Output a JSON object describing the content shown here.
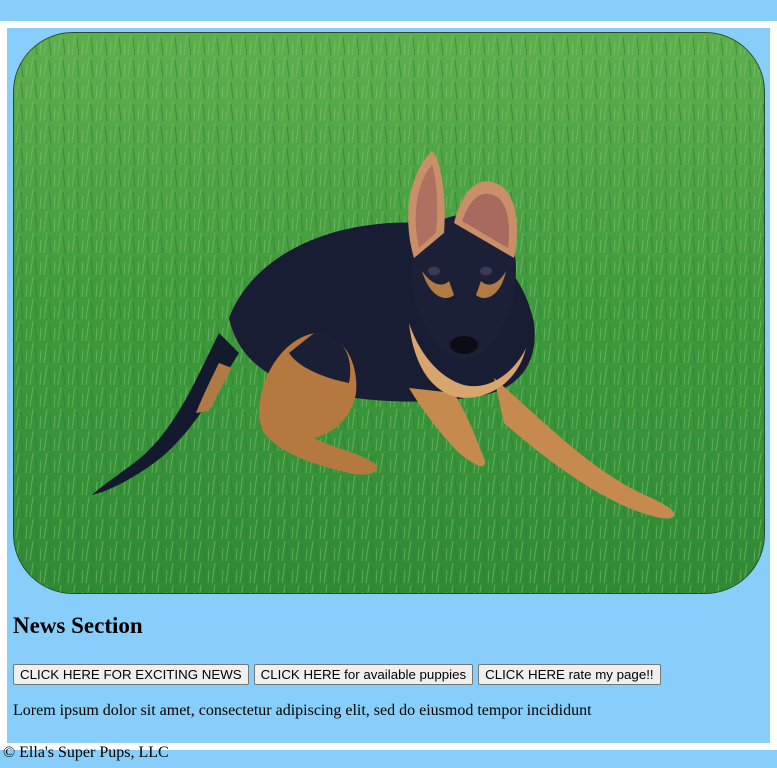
{
  "hero": {
    "image_alt": "German Shepherd puppy lying on green grass"
  },
  "news": {
    "title": "News Section",
    "buttons": [
      "CLICK HERE FOR EXCITING NEWS",
      "CLICK HERE for available puppies",
      "CLICK HERE rate my page!!"
    ],
    "body": "Lorem ipsum dolor sit amet, consectetur adipiscing elit, sed do eiusmod tempor incididunt"
  },
  "footer": {
    "text": "© Ella's Super Pups, LLC"
  },
  "colors": {
    "page_background": "#87cefa",
    "frame_border": "#ffffff",
    "grass": "#3f9a3a"
  }
}
